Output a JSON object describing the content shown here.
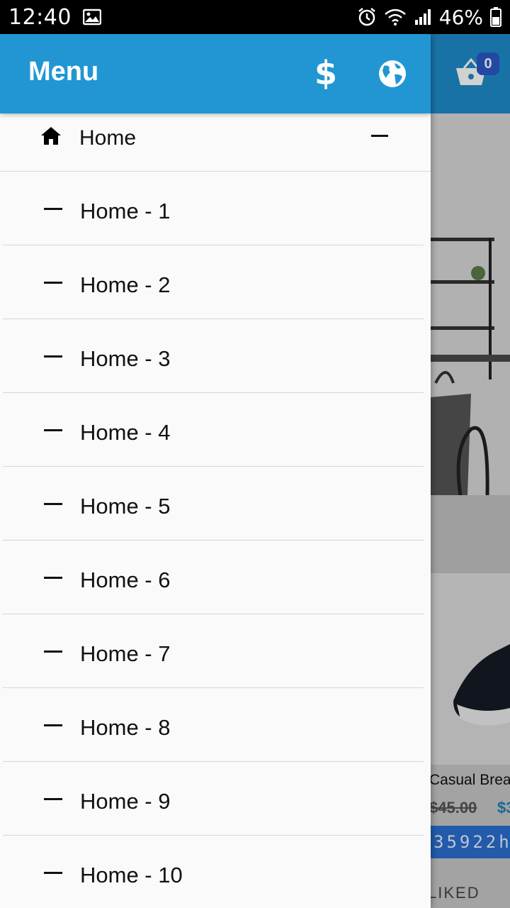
{
  "status_bar": {
    "time": "12:40",
    "battery": "46%",
    "icons": [
      "image-notification-icon",
      "alarm-icon",
      "wifi-icon",
      "signal-icon",
      "battery-icon"
    ]
  },
  "background": {
    "cart_count": "0",
    "product_title": "Casual Brea",
    "old_price": "$45.00",
    "new_price": "$3",
    "code_text": "35922h:",
    "liked_label": "LIKED"
  },
  "drawer": {
    "title": "Menu",
    "header_icons": [
      "dollar-icon",
      "globe-icon"
    ],
    "home_item": {
      "label": "Home",
      "icon": "home-icon",
      "expanded": true
    },
    "sub_items": [
      {
        "label": "Home - 1"
      },
      {
        "label": "Home - 2"
      },
      {
        "label": "Home - 3"
      },
      {
        "label": "Home - 4"
      },
      {
        "label": "Home - 5"
      },
      {
        "label": "Home - 6"
      },
      {
        "label": "Home - 7"
      },
      {
        "label": "Home - 8"
      },
      {
        "label": "Home - 9"
      },
      {
        "label": "Home - 10"
      }
    ]
  },
  "colors": {
    "header_blue": "#2196d3",
    "drawer_bg": "#fafafa",
    "divider": "#d9d9d9",
    "price_blue": "#1e7fb8"
  }
}
